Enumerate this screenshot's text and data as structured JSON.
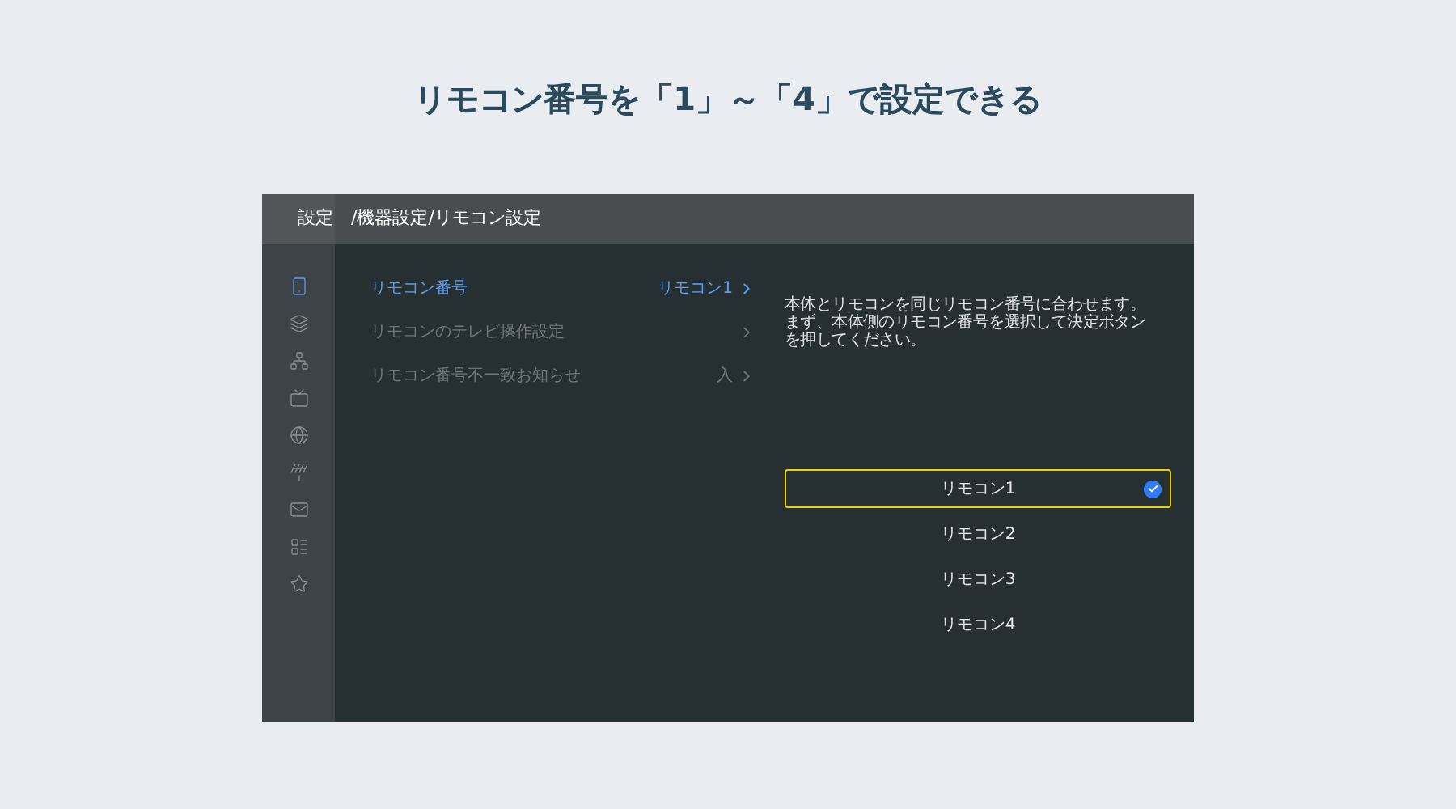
{
  "heading": "リモコン番号を「1」～「4」で設定できる",
  "header": {
    "section": "設定",
    "path": "/機器設定/リモコン設定"
  },
  "sidebar": {
    "items": [
      {
        "selected": true
      },
      {
        "selected": false
      },
      {
        "selected": false
      },
      {
        "selected": false
      },
      {
        "selected": false
      },
      {
        "selected": false
      },
      {
        "selected": false
      },
      {
        "selected": false
      },
      {
        "selected": false
      }
    ]
  },
  "menu": [
    {
      "label": "リモコン番号",
      "value": "リモコン1",
      "selected": true,
      "disabled": false
    },
    {
      "label": "リモコンのテレビ操作設定",
      "selected": false,
      "disabled": true
    },
    {
      "label": "リモコン番号不一致お知らせ",
      "value": "入",
      "selected": false,
      "disabled": true
    }
  ],
  "description": [
    "本体とリモコンを同じリモコン番号に合わせます。",
    "まず、本体側のリモコン番号を選択して決定ボタン",
    "を押してください。"
  ],
  "options": [
    {
      "label": "リモコン1",
      "selected": true
    },
    {
      "label": "リモコン2",
      "selected": false
    },
    {
      "label": "リモコン3",
      "selected": false
    },
    {
      "label": "リモコン4",
      "selected": false
    }
  ]
}
